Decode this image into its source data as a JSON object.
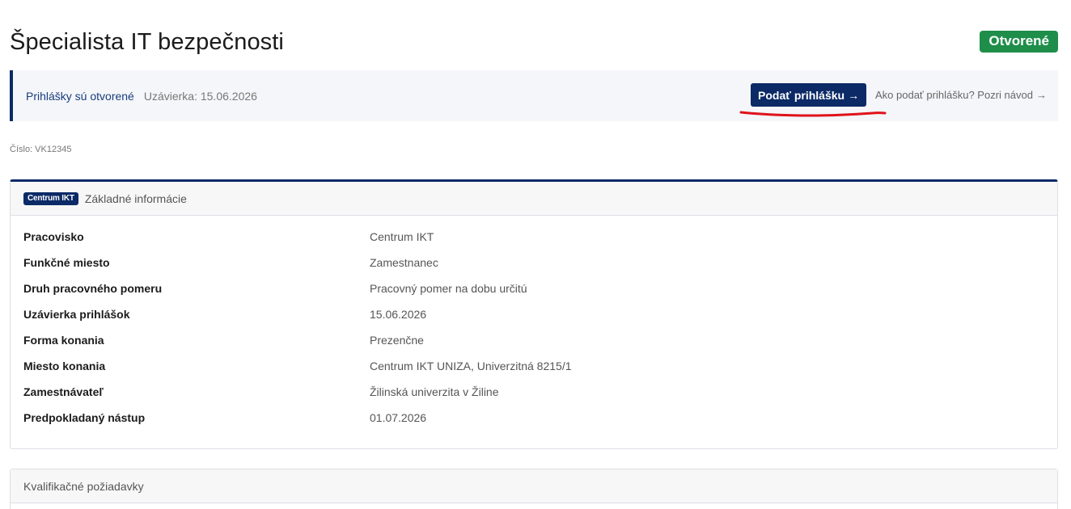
{
  "header": {
    "title": "Špecialista IT bezpečnosti",
    "status_badge": "Otvorené"
  },
  "notice": {
    "status_text": "Prihlášky sú otvorené",
    "deadline_text": "Uzávierka: 15.06.2026",
    "apply_button_label": "Podať prihlášku",
    "apply_button_arrow": "→",
    "guide_link_label": "Ako podať prihlášku? Pozri návod",
    "guide_link_arrow": "→"
  },
  "job_number": "Číslo: VK12345",
  "basic_info": {
    "org_badge": "Centrum IKT",
    "title": "Základné informácie",
    "rows": [
      {
        "label": "Pracovisko",
        "value": "Centrum IKT"
      },
      {
        "label": "Funkčné miesto",
        "value": "Zamestnanec"
      },
      {
        "label": "Druh pracovného pomeru",
        "value": "Pracovný pomer na dobu určitú"
      },
      {
        "label": "Uzávierka prihlášok",
        "value": "15.06.2026"
      },
      {
        "label": "Forma konania",
        "value": "Prezenčne"
      },
      {
        "label": "Miesto konania",
        "value": "Centrum IKT UNIZA, Univerzitná 8215/1"
      },
      {
        "label": "Zamestnávateľ",
        "value": "Žilinská univerzita v Žiline"
      },
      {
        "label": "Predpokladaný nástup",
        "value": "01.07.2026"
      }
    ]
  },
  "qualification": {
    "title": "Kvalifikačné požiadavky"
  },
  "colors": {
    "primary": "#0b2a66",
    "success": "#1e8e4a",
    "annotation": "#e0121b"
  }
}
